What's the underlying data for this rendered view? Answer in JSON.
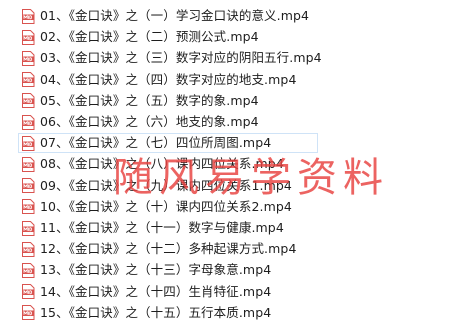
{
  "files": [
    {
      "name": "01、《金口诀》之（一）学习金口诀的意义.mp4"
    },
    {
      "name": "02、《金口诀》之（二）预测公式.mp4"
    },
    {
      "name": "03、《金口诀》之（三）数字对应的阴阳五行.mp4"
    },
    {
      "name": "04、《金口诀》之（四）数字对应的地支.mp4"
    },
    {
      "name": "05、《金口诀》之（五）数字的象.mp4"
    },
    {
      "name": "06、《金口诀》之（六）地支的象.mp4"
    },
    {
      "name": "07、《金口诀》之（七）四位所周图.mp4"
    },
    {
      "name": "08、《金口诀》之（八）课内四位关系.mp4"
    },
    {
      "name": "09、《金口诀》之（九）课内四位关系1.mp4"
    },
    {
      "name": "10、《金口诀》之（十）课内四位关系2.mp4"
    },
    {
      "name": "11、《金口诀》之（十一）数字与健康.mp4"
    },
    {
      "name": "12、《金口诀》之（十二）多种起课方式.mp4"
    },
    {
      "name": "13、《金口诀》之（十三）字母象意.mp4"
    },
    {
      "name": "14、《金口诀》之（十四）生肖特征.mp4"
    },
    {
      "name": "15、《金口诀》之（十五）五行本质.mp4"
    }
  ],
  "icon": {
    "name": "video-file-icon",
    "color": "#d9534f"
  },
  "selected_index": 6,
  "watermark": "随风易学资料"
}
